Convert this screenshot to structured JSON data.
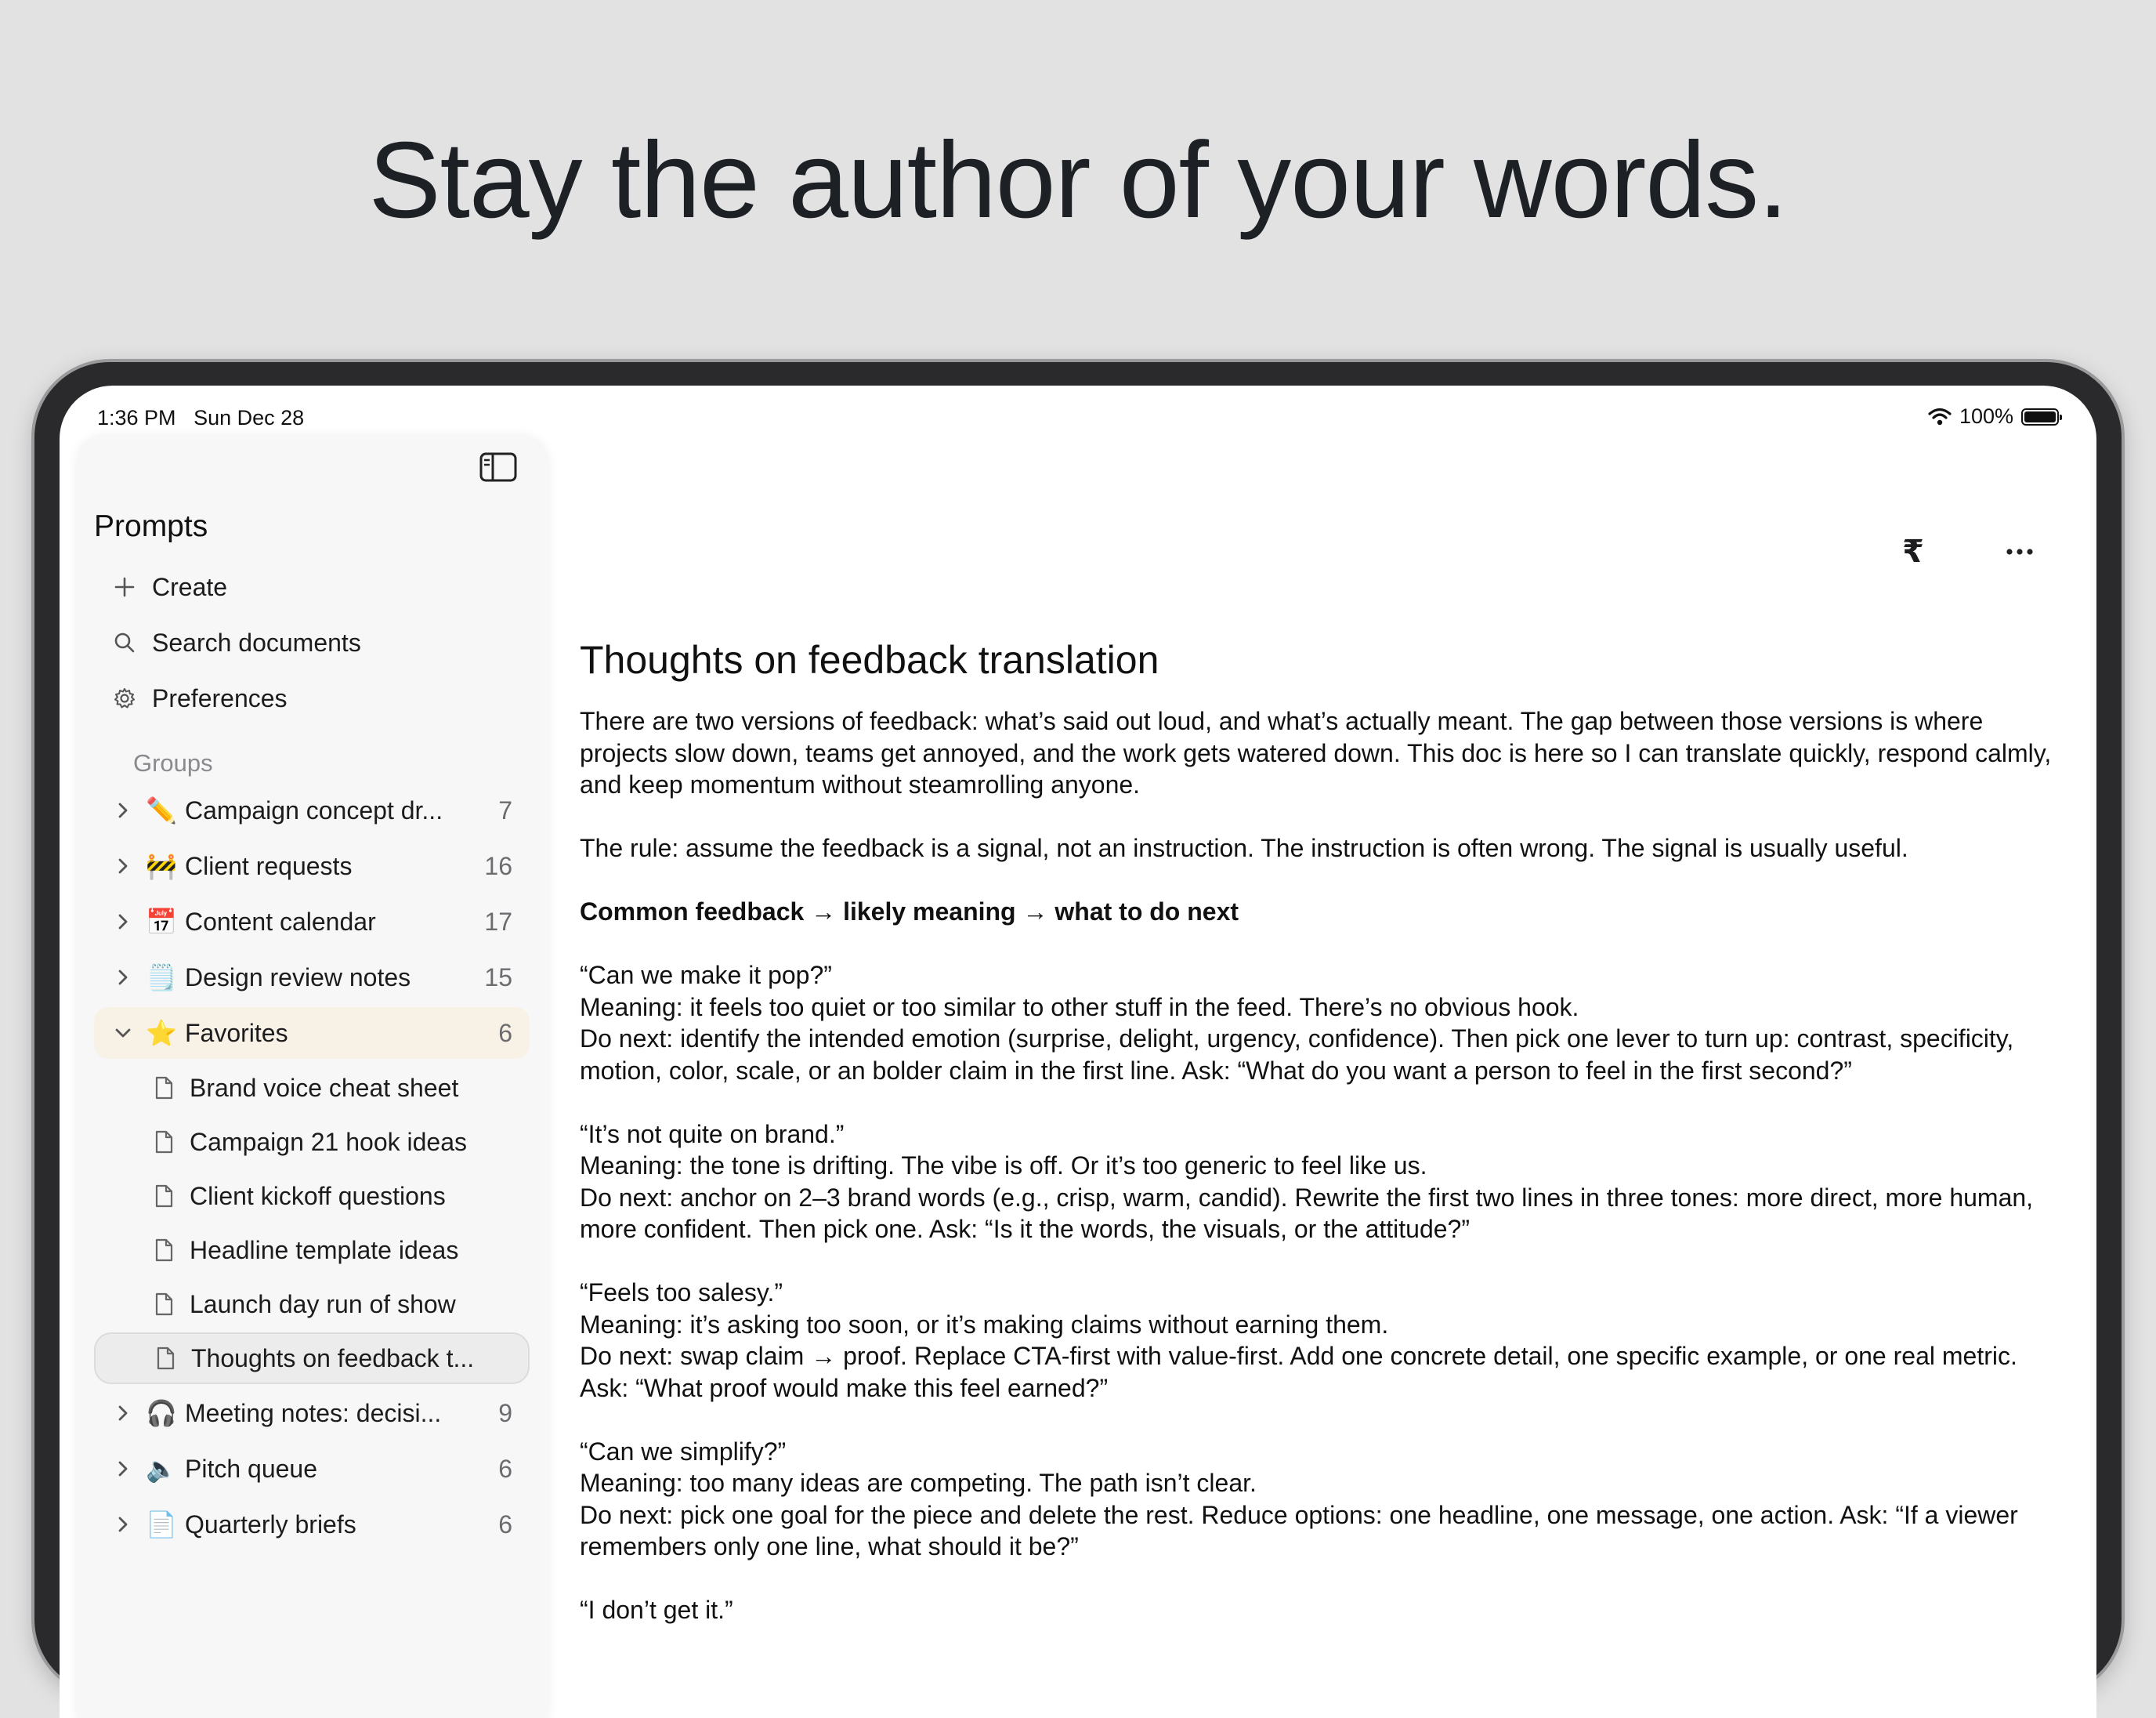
{
  "headline": "Stay the author of your words.",
  "status_bar": {
    "time": "1:36 PM",
    "date": "Sun Dec 28",
    "battery": "100%"
  },
  "sidebar": {
    "title": "Prompts",
    "actions": {
      "create": "Create",
      "search": "Search documents",
      "preferences": "Preferences"
    },
    "groups_label": "Groups",
    "groups_before": [
      {
        "emoji": "✏️",
        "label": "Campaign concept dr...",
        "count": "7"
      },
      {
        "emoji": "🚧",
        "label": "Client requests",
        "count": "16"
      },
      {
        "emoji": "📅",
        "label": "Content calendar",
        "count": "17"
      },
      {
        "emoji": "🗒️",
        "label": "Design review notes",
        "count": "15"
      }
    ],
    "favorites": {
      "emoji": "⭐",
      "label": "Favorites",
      "count": "6",
      "docs": [
        "Brand voice cheat sheet",
        "Campaign 21 hook ideas",
        "Client kickoff questions",
        "Headline template ideas",
        "Launch day run of show",
        "Thoughts on feedback t..."
      ]
    },
    "groups_after": [
      {
        "emoji": "🎧",
        "label": "Meeting notes: decisi...",
        "count": "9"
      },
      {
        "emoji": "🔈",
        "label": "Pitch queue",
        "count": "6"
      },
      {
        "emoji": "📄",
        "label": "Quarterly briefs",
        "count": "6"
      }
    ]
  },
  "toolbar": {
    "format_glyph": "₹"
  },
  "document": {
    "title": "Thoughts on feedback translation",
    "intro": "There are two versions of feedback: what’s said out loud, and what’s actually meant. The gap between those versions is where projects slow down, teams get annoyed, and the work gets watered down. This doc is here so I can translate quickly, respond calmly, and keep momentum without steamrolling anyone.",
    "rule": "The rule: assume the feedback is a signal, not an instruction. The instruction is often wrong. The signal is usually useful.",
    "heading": "Common feedback → likely meaning → what to do next",
    "items": [
      {
        "quote": "“Can we make it pop?”",
        "meaning": "Meaning: it feels too quiet or too similar to other stuff in the feed. There’s no obvious hook.",
        "next": "Do next: identify the intended emotion (surprise, delight, urgency, confidence). Then pick one lever to turn up: contrast, specificity, motion, color, scale, or an bolder claim in the first line. Ask: “What do you want a person to feel in the first second?”"
      },
      {
        "quote": "“It’s not quite on brand.”",
        "meaning": "Meaning: the tone is drifting. The vibe is off. Or it’s too generic to feel like us.",
        "next": "Do next: anchor on 2–3 brand words (e.g., crisp, warm, candid). Rewrite the first two lines in three tones: more direct, more human, more confident. Then pick one. Ask: “Is it the words, the visuals, or the attitude?”"
      },
      {
        "quote": "“Feels too salesy.”",
        "meaning": "Meaning: it’s asking too soon, or it’s making claims without earning them.",
        "next": "Do next: swap claim → proof. Replace CTA-first with value-first. Add one concrete detail, one specific example, or one real metric. Ask: “What proof would make this feel earned?”"
      },
      {
        "quote": "“Can we simplify?”",
        "meaning": "Meaning: too many ideas are competing. The path isn’t clear.",
        "next": "Do next: pick one goal for the piece and delete the rest. Reduce options: one headline, one message, one action. Ask: “If a viewer remembers only one line, what should it be?”"
      }
    ],
    "trailing": "“I don’t get it.”"
  }
}
